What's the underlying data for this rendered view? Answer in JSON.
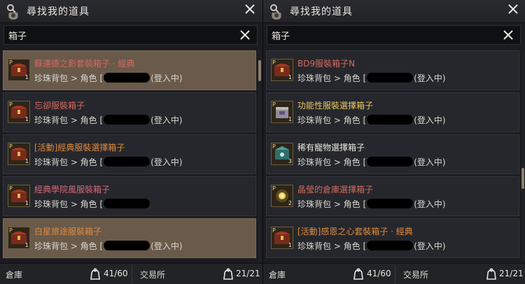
{
  "colors": {
    "name_red": "#d26a5f",
    "name_orange": "#e08a3c",
    "name_pink": "#d46a79",
    "name_yellow": "#e8c763",
    "accent_tan": "#8a7f6e"
  },
  "left": {
    "title": "尋找我的道具",
    "search_value": "箱子",
    "items": [
      {
        "name": "蘇達德之影套裝箱子 · 經典",
        "loc_prefix": "珍珠背包 > 角色 [",
        "loc_suffix": "(登入中)",
        "icon": "chest-icon",
        "count": "1"
      },
      {
        "name": "忘卻服裝箱子",
        "loc_prefix": "珍珠背包 > 角色 [",
        "loc_suffix": "(登入中)",
        "icon": "chest-icon",
        "count": "1"
      },
      {
        "name": "[活動]經典服裝選擇箱子",
        "loc_prefix": "珍珠背包 > 角色 [",
        "loc_suffix": "(登入中)",
        "icon": "chest-icon",
        "count": "1"
      },
      {
        "name": "經典學院風服裝箱子",
        "loc_prefix": "珍珠背包 > 角色 [",
        "loc_suffix": "",
        "icon": "chest-icon",
        "count": "1"
      },
      {
        "name": "白星旅途服裝箱子",
        "loc_prefix": "珍珠背包 > 角色 [",
        "loc_suffix": "(登入中)",
        "icon": "chest-icon",
        "count": "1"
      }
    ],
    "footer": {
      "warehouse_label": "倉庫",
      "warehouse_count": "41/60",
      "market_label": "交易所",
      "market_count": "21/21"
    }
  },
  "right": {
    "title": "尋找我的道具",
    "search_value": "箱子",
    "items": [
      {
        "name": "BD9服裝箱子N",
        "loc_prefix": "珍珠背包 > 角色 [",
        "loc_suffix": "(登入中)",
        "icon": "chest-icon",
        "count": "1"
      },
      {
        "name": "功能性服裝選擇箱子",
        "loc_prefix": "珍珠背包 > 角色 [",
        "loc_suffix": "(登入中)",
        "icon": "box-icon",
        "count": "1"
      },
      {
        "name": "稀有寵物選擇箱子",
        "loc_prefix": "珍珠背包 > 角色 [",
        "loc_suffix": "(登入中)",
        "icon": "pet-box-icon",
        "count": "3"
      },
      {
        "name": "晶瑩的倉庫選擇箱子",
        "loc_prefix": "珍珠背包 > 角色 [",
        "loc_suffix": "(登入中)",
        "icon": "crystal-box-icon",
        "count": "2"
      },
      {
        "name": "[活動]感恩之心套裝箱子 · 經典",
        "loc_prefix": "珍珠背包 > 角色 [",
        "loc_suffix": "(登入中)",
        "icon": "chest-icon",
        "count": "1"
      }
    ],
    "footer": {
      "warehouse_label": "倉庫",
      "warehouse_count": "41/60",
      "market_label": "交易所",
      "market_count": "21/21"
    }
  }
}
